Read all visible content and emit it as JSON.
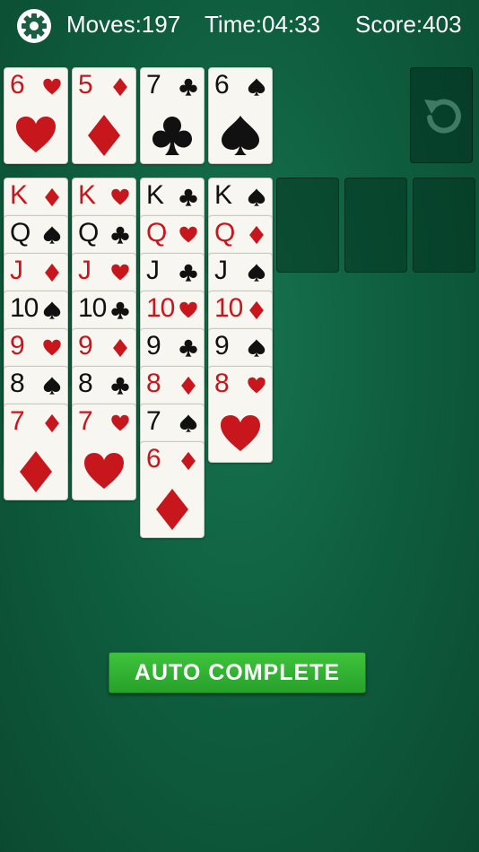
{
  "header": {
    "settings_icon": "gear-icon",
    "moves": "Moves:197",
    "time": "Time:04:33",
    "score": "Score:403"
  },
  "foundations": [
    {
      "rank": "6",
      "suit": "hearts"
    },
    {
      "rank": "5",
      "suit": "diamonds"
    },
    {
      "rank": "7",
      "suit": "clubs"
    },
    {
      "rank": "6",
      "suit": "spades"
    }
  ],
  "undo": {
    "icon": "undo-icon"
  },
  "tableau": [
    [
      {
        "rank": "K",
        "suit": "diamonds"
      },
      {
        "rank": "Q",
        "suit": "spades"
      },
      {
        "rank": "J",
        "suit": "diamonds"
      },
      {
        "rank": "10",
        "suit": "spades"
      },
      {
        "rank": "9",
        "suit": "hearts"
      },
      {
        "rank": "8",
        "suit": "spades"
      },
      {
        "rank": "7",
        "suit": "diamonds"
      }
    ],
    [
      {
        "rank": "K",
        "suit": "hearts"
      },
      {
        "rank": "Q",
        "suit": "clubs"
      },
      {
        "rank": "J",
        "suit": "hearts"
      },
      {
        "rank": "10",
        "suit": "clubs"
      },
      {
        "rank": "9",
        "suit": "diamonds"
      },
      {
        "rank": "8",
        "suit": "clubs"
      },
      {
        "rank": "7",
        "suit": "hearts"
      }
    ],
    [
      {
        "rank": "K",
        "suit": "clubs"
      },
      {
        "rank": "Q",
        "suit": "hearts"
      },
      {
        "rank": "J",
        "suit": "clubs"
      },
      {
        "rank": "10",
        "suit": "hearts"
      },
      {
        "rank": "9",
        "suit": "clubs"
      },
      {
        "rank": "8",
        "suit": "diamonds"
      },
      {
        "rank": "7",
        "suit": "spades"
      },
      {
        "rank": "6",
        "suit": "diamonds"
      }
    ],
    [
      {
        "rank": "K",
        "suit": "spades"
      },
      {
        "rank": "Q",
        "suit": "diamonds"
      },
      {
        "rank": "J",
        "suit": "spades"
      },
      {
        "rank": "10",
        "suit": "diamonds"
      },
      {
        "rank": "9",
        "suit": "spades"
      },
      {
        "rank": "8",
        "suit": "hearts"
      }
    ],
    [],
    [],
    []
  ],
  "auto_complete": {
    "label": "AUTO COMPLETE"
  },
  "colors": {
    "felt": "#0f5f40",
    "red_suit": "#c8161d",
    "black_suit": "#111111",
    "button_green": "#2fae2f"
  }
}
